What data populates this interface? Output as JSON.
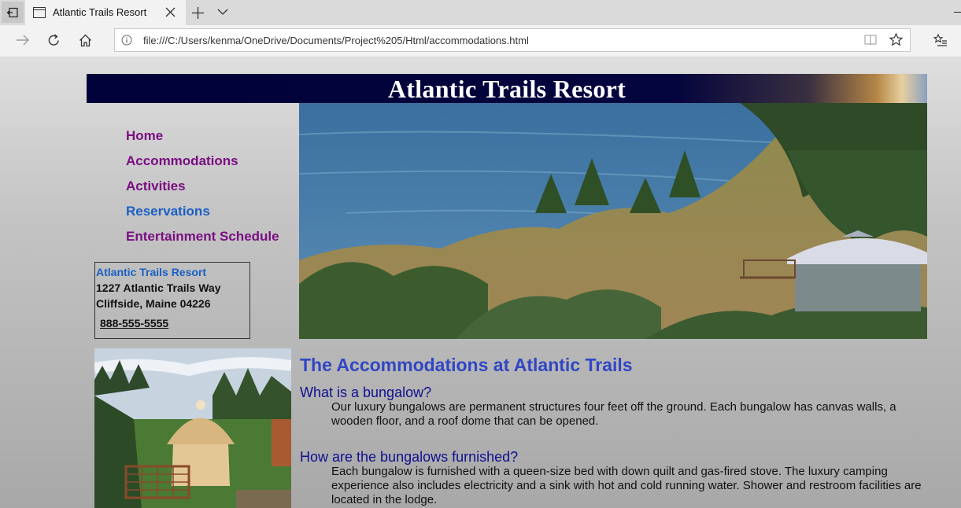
{
  "browser": {
    "tab_title": "Atlantic Trails Resort",
    "url": "file:///C:/Users/kenma/OneDrive/Documents/Project%205/Html/accommodations.html"
  },
  "page": {
    "header_title": "Atlantic Trails Resort",
    "nav": [
      {
        "label": "Home"
      },
      {
        "label": "Accommodations"
      },
      {
        "label": "Activities"
      },
      {
        "label": "Reservations"
      },
      {
        "label": "Entertainment Schedule"
      }
    ],
    "contact": {
      "name": "Atlantic Trails Resort",
      "street": "1227 Atlantic Trails Way",
      "city": "Cliffside, Maine 04226",
      "phone": "888-555-5555"
    },
    "heading": "The Accommodations at Atlantic Trails",
    "faq": [
      {
        "question": "What is a bungalow?",
        "answer": "Our luxury bungalows are permanent structures four feet off the ground. Each bungalow has canvas walls, a wooden floor, and a roof dome that can be opened."
      },
      {
        "question": "How are the bungalows furnished?",
        "answer": "Each bungalow is furnished with a queen-size bed with down quilt and gas-fired stove. The luxury camping experience also includes electricity and a sink with hot and cold running water. Shower and restroom facilities are located in the lodge."
      }
    ]
  },
  "colors": {
    "nav_visited": "#7a0e82",
    "nav_link": "#1a5fc4",
    "heading": "#3146c4",
    "question": "#101090",
    "header_bg": "#02023a"
  }
}
